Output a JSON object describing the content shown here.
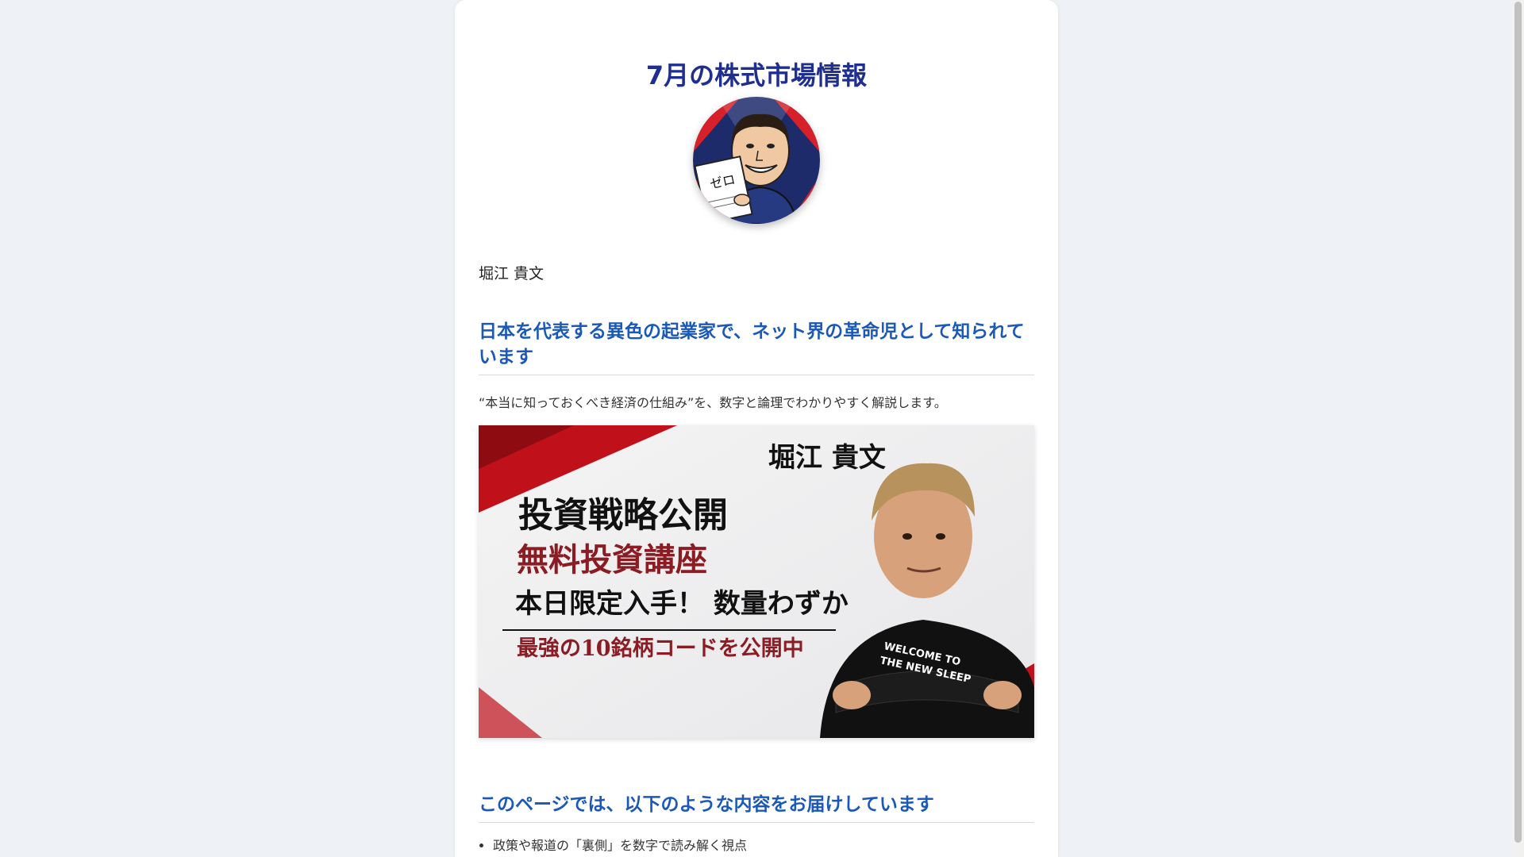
{
  "page": {
    "title": "7月の株式市場情報",
    "author": "堀江 貴文",
    "section1_heading": "日本を代表する異色の起業家で、ネット界の革命児として知られています",
    "description": "“本当に知っておくべき経済の仕組み”を、数字と論理でわかりやすく解説します。",
    "section2_heading": "このページでは、以下のような内容をお届けしています",
    "bullets": [
      "政策や報道の「裏側」を数字で読み解く視点"
    ]
  },
  "avatar": {
    "book_text": "ゼロ"
  },
  "banner": {
    "name": "堀江 貴文",
    "line1": "投資戦略公開",
    "line2": "無料投資講座",
    "line3": "本日限定入手！ 数量わずか",
    "line4": "最強の10銘柄コードを公開中",
    "shirt_text_1": "WELCOME TO",
    "shirt_text_2": "THE NEW SLEEP"
  },
  "colors": {
    "title": "#1f2f8f",
    "heading": "#1b59b8",
    "banner_red": "#c0101a",
    "banner_dark_red": "#8b1c24"
  }
}
